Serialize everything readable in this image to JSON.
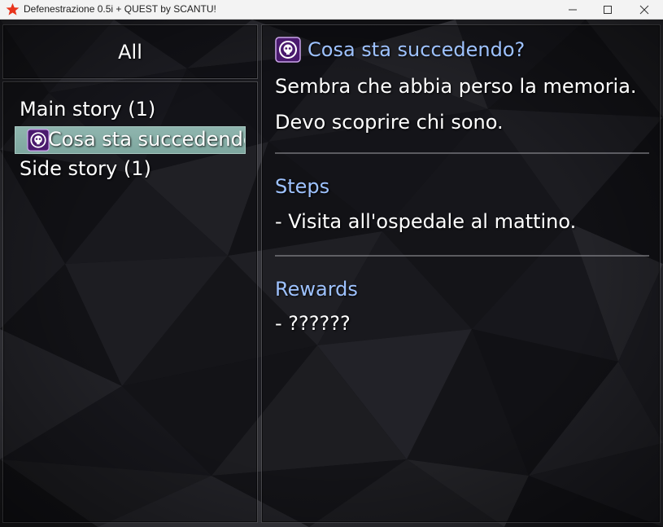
{
  "window": {
    "title": "Defenestrazione 0.5i + QUEST by SCANTU!",
    "icon": "red-star-icon",
    "accent_color": "#e8341c"
  },
  "category_pane": {
    "label": "All"
  },
  "quest_list": {
    "main_story_label": "Main story (1)",
    "selected_quest": {
      "label": "Cosa sta succedendo?",
      "icon": "purple-skull-quest-icon",
      "highlight_color": "#86ada6"
    },
    "side_story_label": "Side story (1)"
  },
  "quest_detail": {
    "icon": "purple-skull-quest-icon",
    "title": "Cosa sta succedendo?",
    "title_color": "#9ec2ff",
    "description": "Sembra che abbia perso la memoria. Devo scoprire chi sono.",
    "steps_heading": "Steps",
    "steps_text": "- Visita all'ospedale al mattino.",
    "rewards_heading": "Rewards",
    "rewards_text": "- ??????"
  }
}
